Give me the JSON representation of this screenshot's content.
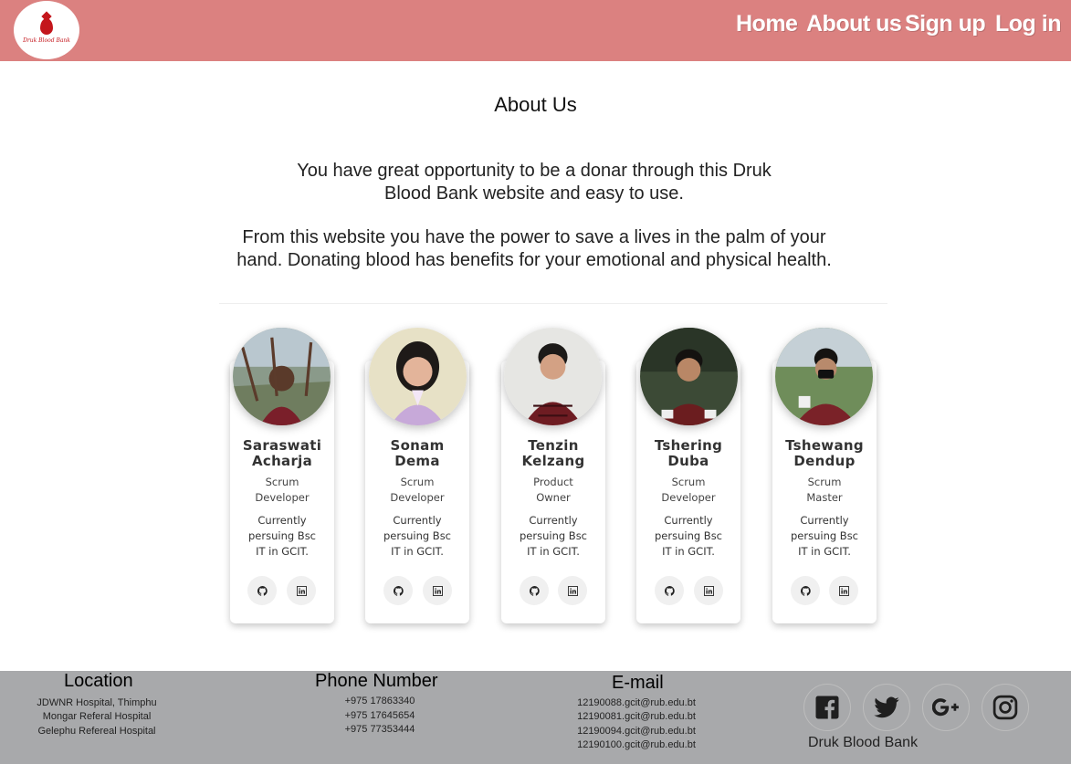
{
  "header": {
    "logo_text": "Druk Blood Bank",
    "nav": [
      {
        "label": "Home"
      },
      {
        "label": "About us"
      },
      {
        "label": "Sign up"
      },
      {
        "label": "Log in"
      }
    ]
  },
  "about": {
    "title": "About Us",
    "paragraph1": "You have great opportunity to be a donar through this  Druk Blood Bank website and easy to use.",
    "paragraph2": "From this website you have the power to save a lives in the palm of your hand. Donating blood has  benefits for your emotional and physical health."
  },
  "team": [
    {
      "name": "Saraswati Acharja",
      "role": "Scrum Developer",
      "desc": "Currently persuing Bsc IT in GCIT.",
      "icons": [
        "github-icon",
        "linkedin-icon"
      ]
    },
    {
      "name": "Sonam Dema",
      "role": "Scrum Developer",
      "desc": "Currently persuing Bsc IT in GCIT.",
      "icons": [
        "github-icon",
        "linkedin-icon"
      ]
    },
    {
      "name": "Tenzin Kelzang",
      "role": "Product Owner",
      "desc": "Currently persuing Bsc IT in GCIT.",
      "icons": [
        "github-icon",
        "linkedin-icon"
      ]
    },
    {
      "name": "Tshering Duba",
      "role": "Scrum Developer",
      "desc": "Currently persuing Bsc IT in GCIT.",
      "icons": [
        "github-icon",
        "linkedin-icon"
      ]
    },
    {
      "name": "Tshewang Dendup",
      "role": "Scrum Master",
      "desc": "Currently persuing Bsc IT in GCIT.",
      "icons": [
        "github-icon",
        "linkedin-icon"
      ]
    }
  ],
  "footer": {
    "location": {
      "title": "Location",
      "lines": [
        "JDWNR Hospital, Thimphu",
        "Mongar Referal Hospital",
        "Gelephu Refereal Hospital"
      ]
    },
    "phone": {
      "title": "Phone Number",
      "lines": [
        "+975 17863340",
        "+975 17645654",
        "+975 77353444"
      ]
    },
    "email": {
      "title": "E-mail",
      "lines": [
        "12190088.gcit@rub.edu.bt",
        "12190081.gcit@rub.edu.bt",
        "12190094.gcit@rub.edu.bt",
        "12190100.gcit@rub.edu.bt"
      ]
    },
    "social_icons": [
      "facebook-icon",
      "twitter-icon",
      "google-plus-icon",
      "instagram-icon"
    ],
    "brand": "Druk Blood Bank"
  },
  "colors": {
    "header_bg": "#db8180",
    "footer_bg": "#a8a9ab",
    "logo_red": "#c4161c"
  }
}
